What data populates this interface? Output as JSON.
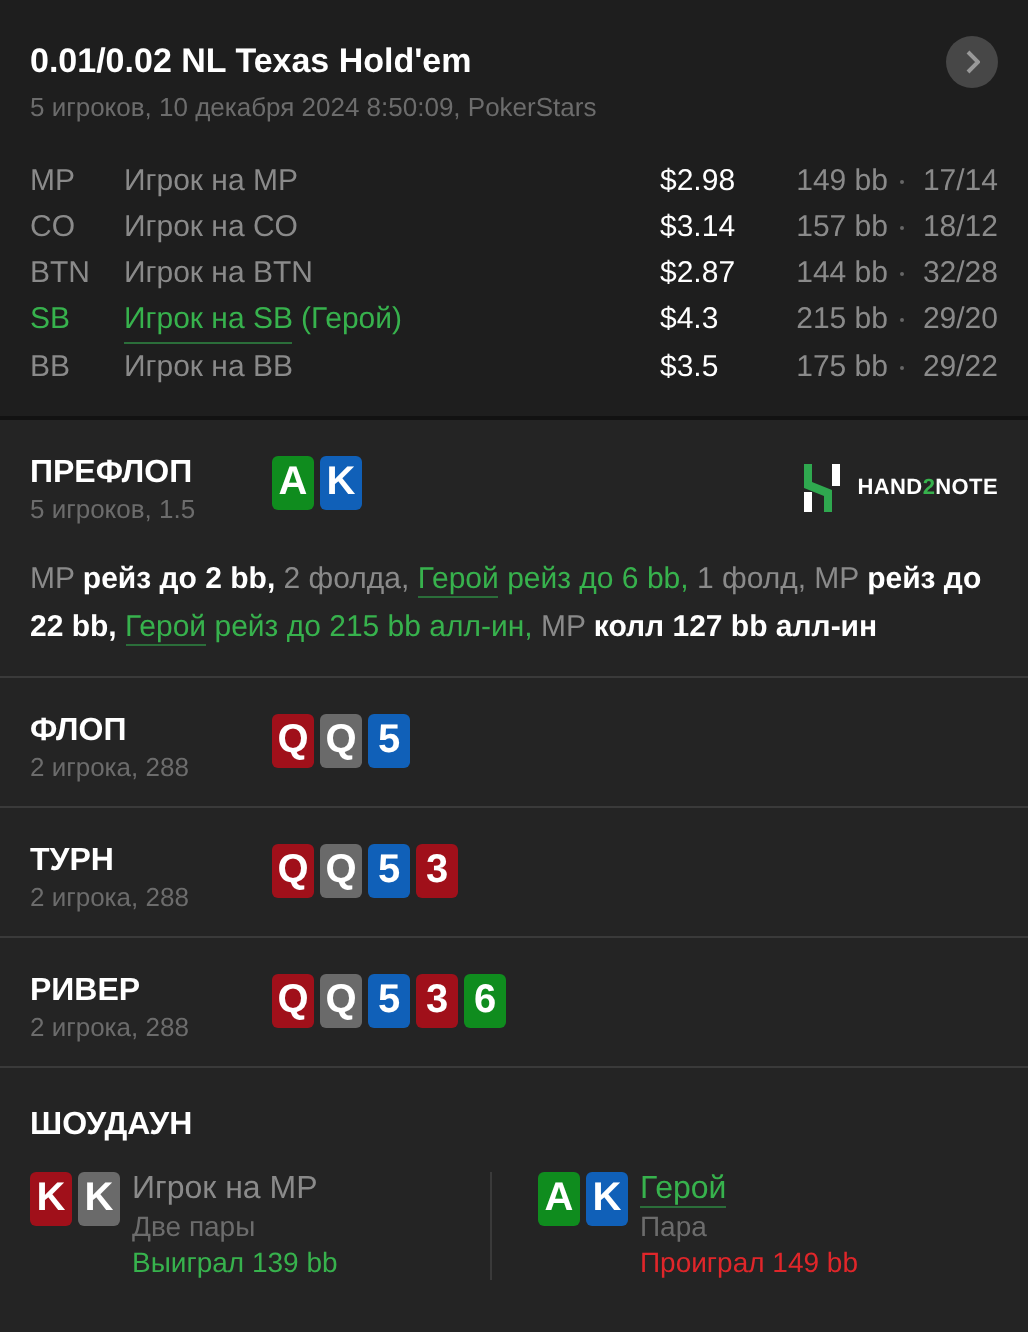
{
  "header": {
    "title": "0.01/0.02 NL Texas Hold'em",
    "subtitle": "5 игроков, 10 декабря 2024 8:50:09, PokerStars"
  },
  "players": [
    {
      "position": "MP",
      "name": "Игрок на MP",
      "stack": "$2.98",
      "bb": "149 bb",
      "ratio": "17/14",
      "hero": false
    },
    {
      "position": "CO",
      "name": "Игрок на CO",
      "stack": "$3.14",
      "bb": "157 bb",
      "ratio": "18/12",
      "hero": false
    },
    {
      "position": "BTN",
      "name": "Игрок на BTN",
      "stack": "$2.87",
      "bb": "144 bb",
      "ratio": "32/28",
      "hero": false
    },
    {
      "position": "SB",
      "name": "Игрок на SB",
      "hero_tag": "(Герой)",
      "stack": "$4.3",
      "bb": "215 bb",
      "ratio": "29/20",
      "hero": true
    },
    {
      "position": "BB",
      "name": "Игрок на BB",
      "stack": "$3.5",
      "bb": "175 bb",
      "ratio": "29/22",
      "hero": false
    }
  ],
  "logo": {
    "parts": [
      "HAND",
      "2",
      "NOTE"
    ]
  },
  "streets": [
    {
      "name": "ПРЕФЛОП",
      "info": "5 игроков, 1.5",
      "cards": [
        {
          "rank": "A",
          "color": "#0f8c1e"
        },
        {
          "rank": "K",
          "color": "#1060b8"
        }
      ],
      "actions": [
        {
          "kind": "pos",
          "text": "MP"
        },
        {
          "kind": "action",
          "text": "рейз до 2 bb,"
        },
        {
          "kind": "pos",
          "text": "2 фолда,"
        },
        {
          "kind": "hero_link",
          "text": "Герой"
        },
        {
          "kind": "hero",
          "text": "рейз до 6 bb,"
        },
        {
          "kind": "pos",
          "text": "1 фолд, MP"
        },
        {
          "kind": "action",
          "text": "рейз до 22 bb,"
        },
        {
          "kind": "hero_link",
          "text": "Герой"
        },
        {
          "kind": "hero",
          "text": "рейз до 215 bb алл-ин,"
        },
        {
          "kind": "pos",
          "text": "MP"
        },
        {
          "kind": "action",
          "text": "колл 127 bb алл-ин"
        }
      ]
    },
    {
      "name": "ФЛОП",
      "info": "2 игрока, 288",
      "cards": [
        {
          "rank": "Q",
          "color": "#a0101a"
        },
        {
          "rank": "Q",
          "color": "#6a6a6a"
        },
        {
          "rank": "5",
          "color": "#1060b8"
        }
      ]
    },
    {
      "name": "ТУРН",
      "info": "2 игрока, 288",
      "cards": [
        {
          "rank": "Q",
          "color": "#a0101a"
        },
        {
          "rank": "Q",
          "color": "#6a6a6a"
        },
        {
          "rank": "5",
          "color": "#1060b8"
        },
        {
          "rank": "3",
          "color": "#a0101a"
        }
      ]
    },
    {
      "name": "РИВЕР",
      "info": "2 игрока, 288",
      "cards": [
        {
          "rank": "Q",
          "color": "#a0101a"
        },
        {
          "rank": "Q",
          "color": "#6a6a6a"
        },
        {
          "rank": "5",
          "color": "#1060b8"
        },
        {
          "rank": "3",
          "color": "#a0101a"
        },
        {
          "rank": "6",
          "color": "#0f8c1e"
        }
      ]
    }
  ],
  "showdown": {
    "title": "ШОУДАУН",
    "hands": [
      {
        "player": "Игрок на MP",
        "hero": false,
        "combo": "Две пары",
        "result": "Выиграл 139 bb",
        "won": true,
        "cards": [
          {
            "rank": "K",
            "color": "#a0101a"
          },
          {
            "rank": "K",
            "color": "#6a6a6a"
          }
        ]
      },
      {
        "player": "Герой",
        "hero": true,
        "combo": "Пара",
        "result": "Проиграл 149 bb",
        "won": false,
        "cards": [
          {
            "rank": "A",
            "color": "#0f8c1e"
          },
          {
            "rank": "K",
            "color": "#1060b8"
          }
        ]
      }
    ]
  }
}
